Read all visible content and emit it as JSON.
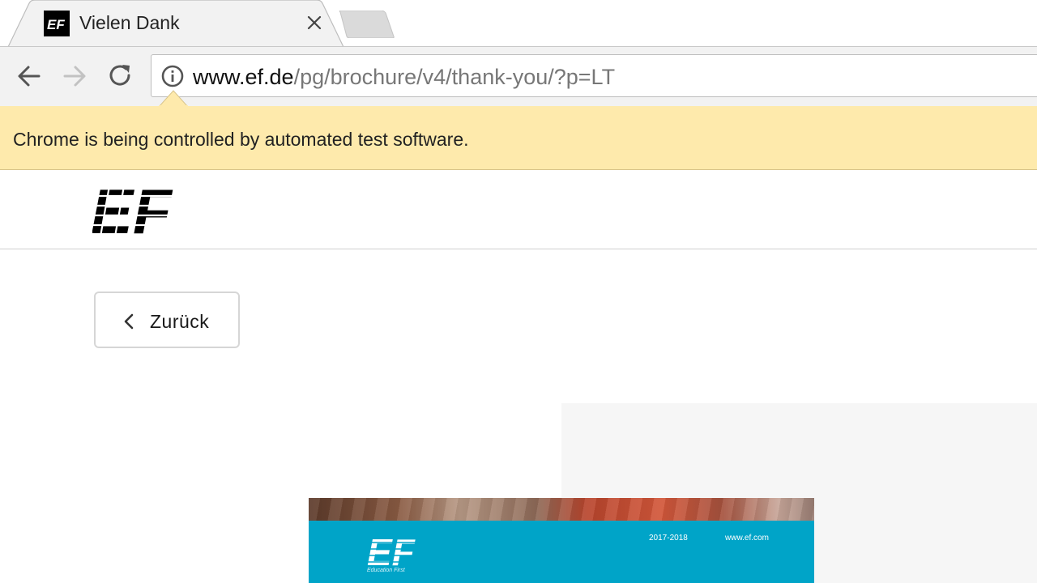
{
  "browser": {
    "tab": {
      "title": "Vielen Dank",
      "favicon_text": "EF"
    },
    "address_bar": {
      "host": "www.ef.de",
      "path": "/pg/brochure/v4/thank-you/?p=LT"
    },
    "infobar": {
      "message": "Chrome is being controlled by automated test software."
    },
    "icons": {
      "back": "arrow-left-icon",
      "forward": "arrow-right-icon",
      "reload": "reload-icon",
      "info": "info-icon",
      "close": "close-icon"
    }
  },
  "page": {
    "logo_text": "EF",
    "back_button": {
      "label": "Zurück"
    },
    "brochure": {
      "logo_text": "EF",
      "subtitle": "Education First",
      "years": "2017-2018",
      "website": "www.ef.com"
    }
  },
  "colors": {
    "infobar_bg": "#feeaac",
    "toolbar_bg": "#f2f2f2",
    "brochure_band": "#00a4c8"
  }
}
